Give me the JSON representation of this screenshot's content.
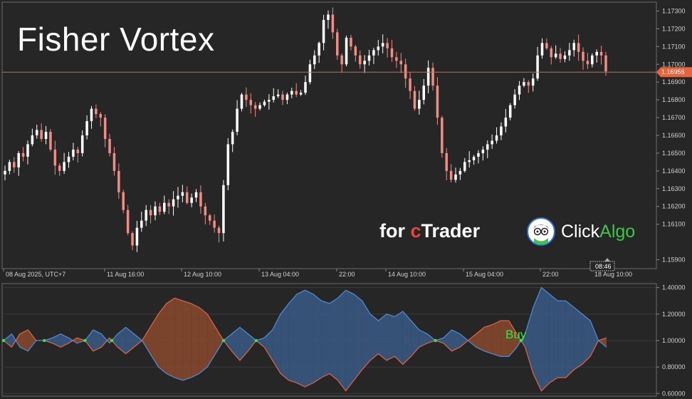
{
  "title": "Fisher Vortex",
  "branding": {
    "for": "for ",
    "c": "c",
    "trader": "Trader",
    "click": "Click",
    "algo": "Algo"
  },
  "colors": {
    "bg": "#262626",
    "grid": "#3a3a3a",
    "up": "#ffffff",
    "down": "#f28b82",
    "accent": "#e8643c",
    "vortex_plus": "#4a90e2",
    "vortex_minus": "#e8643c",
    "signal": "#3ee04a"
  },
  "price_pane": {
    "y_ticks": [
      "1.17300",
      "1.17200",
      "1.17100",
      "1.17000",
      "1.16900",
      "1.16800",
      "1.16700",
      "1.16600",
      "1.16500",
      "1.16400",
      "1.16300",
      "1.16200",
      "1.16100",
      "1.15900"
    ],
    "ylim": [
      1.1585,
      1.1735
    ],
    "current_price_label": "1.16956",
    "current_price": 1.16956,
    "time_tag": "08:46"
  },
  "x_labels": [
    "08 Aug 2025, UTC+7",
    "11 Aug 16:00",
    "12 Aug 10:00",
    "13 Aug 04:00",
    "22:00",
    "14 Aug 10:00",
    "15 Aug 04:00",
    "22:00",
    "18 Aug 10:00"
  ],
  "indicator_pane": {
    "y_ticks": [
      "1.40000",
      "1.20000",
      "1.00000",
      "0.80000",
      "0.60000"
    ],
    "ylim": [
      0.58,
      1.43
    ],
    "buy_label": "Buy"
  },
  "chart_data": {
    "type": "candlestick",
    "title": "Fisher Vortex",
    "close": [
      1.164,
      1.1645,
      1.1642,
      1.165,
      1.1648,
      1.1655,
      1.166,
      1.1663,
      1.1658,
      1.1662,
      1.1652,
      1.1643,
      1.164,
      1.1645,
      1.1648,
      1.1652,
      1.165,
      1.166,
      1.1668,
      1.1675,
      1.1672,
      1.167,
      1.1658,
      1.165,
      1.164,
      1.1628,
      1.1618,
      1.1605,
      1.1598,
      1.1608,
      1.1612,
      1.1618,
      1.1615,
      1.162,
      1.1617,
      1.1622,
      1.162,
      1.1624,
      1.1626,
      1.1628,
      1.1622,
      1.1625,
      1.1628,
      1.162,
      1.1615,
      1.1612,
      1.1608,
      1.1605,
      1.1632,
      1.1655,
      1.1662,
      1.1675,
      1.1683,
      1.168,
      1.1677,
      1.1675,
      1.1677,
      1.1679,
      1.168,
      1.1682,
      1.1683,
      1.168,
      1.1683,
      1.1685,
      1.1683,
      1.1684,
      1.169,
      1.17,
      1.1705,
      1.1712,
      1.1725,
      1.1728,
      1.1718,
      1.1705,
      1.17,
      1.1715,
      1.171,
      1.1705,
      1.17,
      1.1702,
      1.1705,
      1.1708,
      1.171,
      1.1712,
      1.1709,
      1.1704,
      1.1702,
      1.17,
      1.1692,
      1.1685,
      1.1675,
      1.168,
      1.1688,
      1.1698,
      1.1688,
      1.167,
      1.165,
      1.164,
      1.1635,
      1.1638,
      1.164,
      1.1645,
      1.1646,
      1.1648,
      1.165,
      1.1652,
      1.1655,
      1.1657,
      1.166,
      1.1665,
      1.167,
      1.1677,
      1.1683,
      1.1688,
      1.169,
      1.1688,
      1.1692,
      1.1705,
      1.1712,
      1.1709,
      1.1704,
      1.1706,
      1.1703,
      1.1705,
      1.1708,
      1.1712,
      1.1707,
      1.1702,
      1.17,
      1.1705,
      1.1707,
      1.1705,
      1.1696
    ],
    "ylim": [
      1.1585,
      1.1735
    ],
    "indicator": {
      "name": "Fisher Vortex",
      "vi_plus": [
        1.0,
        1.05,
        0.95,
        0.92,
        1.0,
        1.0,
        1.02,
        1.05,
        1.02,
        0.98,
        1.0,
        1.08,
        1.05,
        0.98,
        1.05,
        1.1,
        1.05,
        1.0,
        0.9,
        0.8,
        0.75,
        0.72,
        0.7,
        0.72,
        0.75,
        0.8,
        0.9,
        1.0,
        1.05,
        1.1,
        1.05,
        1.0,
        1.02,
        1.08,
        1.2,
        1.28,
        1.35,
        1.38,
        1.35,
        1.3,
        1.28,
        1.32,
        1.38,
        1.35,
        1.3,
        1.2,
        1.15,
        1.2,
        1.18,
        1.22,
        1.15,
        1.08,
        1.05,
        1.0,
        1.02,
        1.08,
        1.05,
        1.0,
        0.95,
        0.92,
        0.9,
        0.88,
        0.88,
        0.95,
        1.05,
        1.25,
        1.4,
        1.35,
        1.3,
        1.3,
        1.25,
        1.2,
        1.15,
        1.0,
        0.95
      ],
      "vi_minus": [
        1.0,
        0.95,
        1.05,
        1.08,
        1.0,
        1.0,
        0.98,
        0.95,
        0.98,
        1.02,
        1.0,
        0.92,
        0.95,
        1.02,
        0.95,
        0.9,
        0.95,
        1.0,
        1.1,
        1.2,
        1.28,
        1.32,
        1.3,
        1.28,
        1.25,
        1.2,
        1.1,
        1.0,
        0.92,
        0.85,
        0.92,
        1.0,
        0.95,
        0.85,
        0.75,
        0.7,
        0.68,
        0.65,
        0.68,
        0.72,
        0.75,
        0.7,
        0.62,
        0.7,
        0.78,
        0.85,
        0.9,
        0.85,
        0.88,
        0.82,
        0.88,
        0.95,
        0.98,
        1.0,
        0.98,
        0.92,
        0.95,
        1.0,
        1.05,
        1.1,
        1.12,
        1.15,
        1.15,
        1.05,
        0.95,
        0.75,
        0.62,
        0.68,
        0.72,
        0.72,
        0.78,
        0.82,
        0.88,
        1.0,
        1.02
      ]
    }
  }
}
